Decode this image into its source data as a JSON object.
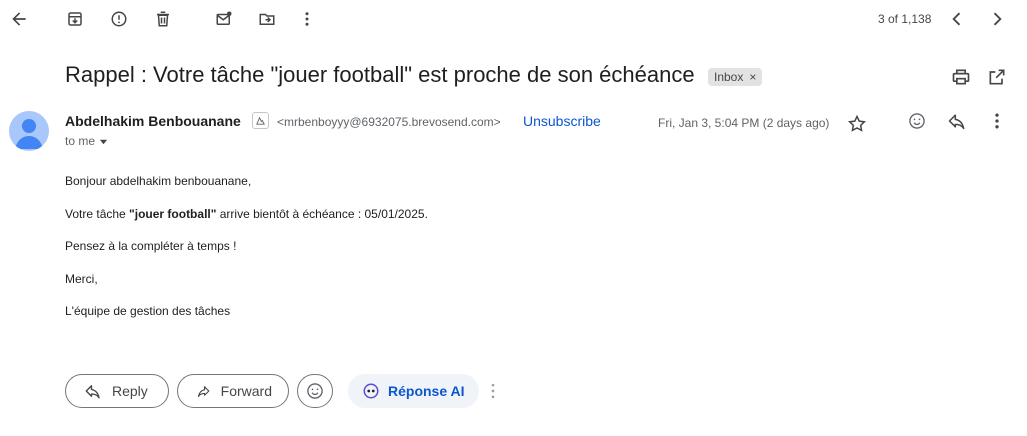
{
  "toolbar": {
    "counter": "3 of 1,138",
    "icons": [
      "back-arrow-icon",
      "archive-icon",
      "report-spam-icon",
      "delete-icon",
      "mark-unread-icon",
      "move-to-icon",
      "more-vert-icon",
      "chevron-left-icon",
      "chevron-right-icon"
    ]
  },
  "email": {
    "subject": "Rappel : Votre tâche \"jouer football\" est proche de son échéance",
    "label_chip": "Inbox",
    "label_close": "×",
    "sender_name": "Abdelhakim Benbouanane",
    "sender_email": "<mrbenboyyy@6932075.brevosend.com>",
    "unsubscribe": "Unsubscribe",
    "to": "to me",
    "date": "Fri, Jan 3, 5:04 PM (2 days ago)",
    "body": {
      "greeting": "Bonjour abdelhakim benbouanane,",
      "line2_prefix": "Votre tâche ",
      "line2_bold": "\"jouer football\"",
      "line2_suffix": " arrive bientôt à échéance : 05/01/2025.",
      "line3": "Pensez à la compléter à temps !",
      "line4": "Merci,",
      "signature": "L'équipe de gestion des tâches"
    }
  },
  "actions": {
    "reply": "Reply",
    "forward": "Forward",
    "ai": "Réponse AI"
  },
  "colors": {
    "link_blue": "#0b57d0",
    "avatar_bg": "#a8c7fa",
    "avatar_fg": "#4285f4",
    "chip_bg": "#e2e2e2"
  }
}
